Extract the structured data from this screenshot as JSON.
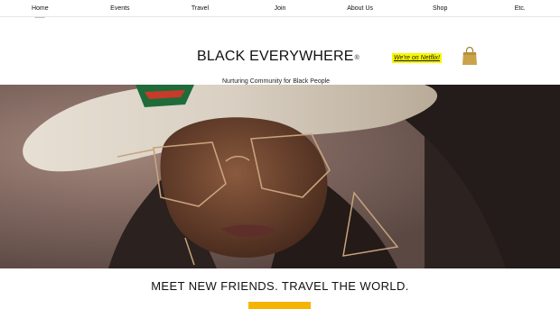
{
  "nav": {
    "items": [
      {
        "label": "Home"
      },
      {
        "label": "Events"
      },
      {
        "label": "Travel"
      },
      {
        "label": "Join"
      },
      {
        "label": "About Us"
      },
      {
        "label": "Shop"
      },
      {
        "label": "Etc."
      }
    ]
  },
  "header": {
    "brand": "BLACK EVERYWHERE",
    "registered_mark": "®",
    "tagline": "Nurturing Community for Black People",
    "netflix_link": "We're on Netflix!"
  },
  "hero": {
    "slogan": "MEET NEW FRIENDS.  TRAVEL THE WORLD.",
    "cta_label": ""
  },
  "colors": {
    "highlight": "#f7f700",
    "cta": "#f5b400",
    "bag": "#c9a24a"
  },
  "icons": {
    "bag": "shopping-bag-icon"
  }
}
